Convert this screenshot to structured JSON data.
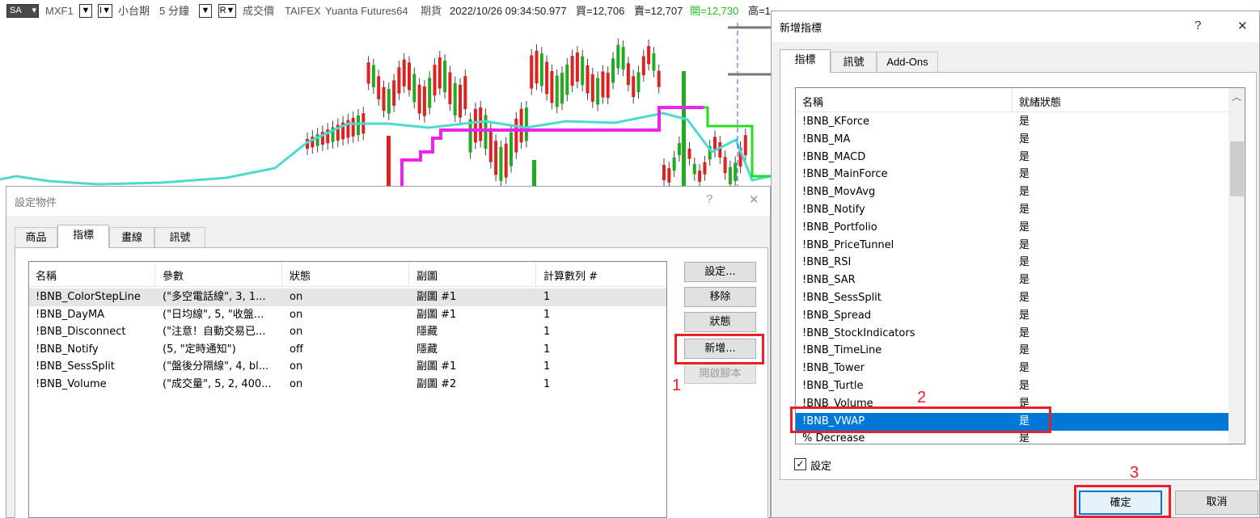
{
  "topbar": {
    "symbol_box": "SA",
    "symbol": "MXF1",
    "btn1": "▼",
    "btn2": "I▼",
    "product": "小台期",
    "interval": "5 分鐘",
    "btn3": "▼",
    "btn4": "R▼",
    "price_type": "成交價",
    "exchange": "TAIFEX",
    "broker": "Yuanta Futures64",
    "market": "期貨",
    "datetime": "2022/10/26  09:34:50.977",
    "bid": "買=12,706",
    "ask": "賣=12,707",
    "open": "開=12,730",
    "high_partial": "高=1",
    "colors": {
      "open": "#22c022",
      "text": "#555555"
    }
  },
  "chart_data": {
    "type": "candlestick",
    "title": "",
    "xlabel": "",
    "ylabel": "",
    "candles_count": 87,
    "overlays": [
      {
        "color": "#4dd9d0"
      },
      {
        "color": "#ee22ee"
      },
      {
        "color": "#22dd22"
      }
    ],
    "colors": {
      "up": "#dd2222",
      "down": "#22aa22"
    }
  },
  "dialog1": {
    "title": "設定物件",
    "help": "?",
    "close": "✕",
    "tabs": [
      "商品",
      "指標",
      "畫線",
      "訊號"
    ],
    "active_tab": 1,
    "columns": [
      "名稱",
      "參數",
      "狀態",
      "副圖",
      "計算數列 #"
    ],
    "rows": [
      {
        "name": "!BNB_ColorStepLine",
        "params": "(\"多空電話線\", 3, 1...",
        "status": "on",
        "subchart": "副圖 #1",
        "series": "1"
      },
      {
        "name": "!BNB_DayMA",
        "params": "(\"日均線\", 5, \"收盤...",
        "status": "on",
        "subchart": "副圖 #1",
        "series": "1"
      },
      {
        "name": "!BNB_Disconnect",
        "params": "(\"注意！自動交易已...",
        "status": "on",
        "subchart": "隱藏",
        "series": "1"
      },
      {
        "name": "!BNB_Notify",
        "params": "(5, \"定時通知\")",
        "status": "off",
        "subchart": "隱藏",
        "series": "1"
      },
      {
        "name": "!BNB_SessSplit",
        "params": "(\"盤後分隔線\", 4, bl...",
        "status": "on",
        "subchart": "副圖 #1",
        "series": "1"
      },
      {
        "name": "!BNB_Volume",
        "params": "(\"成交量\", 5, 2, 400...",
        "status": "on",
        "subchart": "副圖 #2",
        "series": "1"
      }
    ],
    "buttons": {
      "settings": "設定...",
      "remove": "移除",
      "status": "狀態",
      "add": "新增...",
      "open_script": "開啟腳本"
    }
  },
  "dialog2": {
    "title": "新增指標",
    "help": "?",
    "close": "✕",
    "tabs": [
      "指標",
      "訊號",
      "Add-Ons"
    ],
    "active_tab": 0,
    "columns": [
      "名稱",
      "就緒狀態"
    ],
    "rows": [
      {
        "name": "!BNB_KForce",
        "ready": "是"
      },
      {
        "name": "!BNB_MA",
        "ready": "是"
      },
      {
        "name": "!BNB_MACD",
        "ready": "是"
      },
      {
        "name": "!BNB_MainForce",
        "ready": "是"
      },
      {
        "name": "!BNB_MovAvg",
        "ready": "是"
      },
      {
        "name": "!BNB_Notify",
        "ready": "是"
      },
      {
        "name": "!BNB_Portfolio",
        "ready": "是"
      },
      {
        "name": "!BNB_PriceTunnel",
        "ready": "是"
      },
      {
        "name": "!BNB_RSI",
        "ready": "是"
      },
      {
        "name": "!BNB_SAR",
        "ready": "是"
      },
      {
        "name": "!BNB_SessSplit",
        "ready": "是"
      },
      {
        "name": "!BNB_Spread",
        "ready": "是"
      },
      {
        "name": "!BNB_StockIndicators",
        "ready": "是"
      },
      {
        "name": "!BNB_TimeLine",
        "ready": "是"
      },
      {
        "name": "!BNB_Tower",
        "ready": "是"
      },
      {
        "name": "!BNB_Turtle",
        "ready": "是"
      },
      {
        "name": "!BNB_Volume",
        "ready": "是"
      },
      {
        "name": "!BNB_VWAP",
        "ready": "是"
      },
      {
        "name": "% Decrease",
        "ready": "是"
      }
    ],
    "selected_index": 17,
    "checkbox_label": "設定",
    "checkbox_checked": true,
    "ok": "確定",
    "cancel": "取消"
  },
  "annotations": {
    "n1": "1",
    "n2": "2",
    "n3": "3",
    "color": "#e8202a"
  }
}
